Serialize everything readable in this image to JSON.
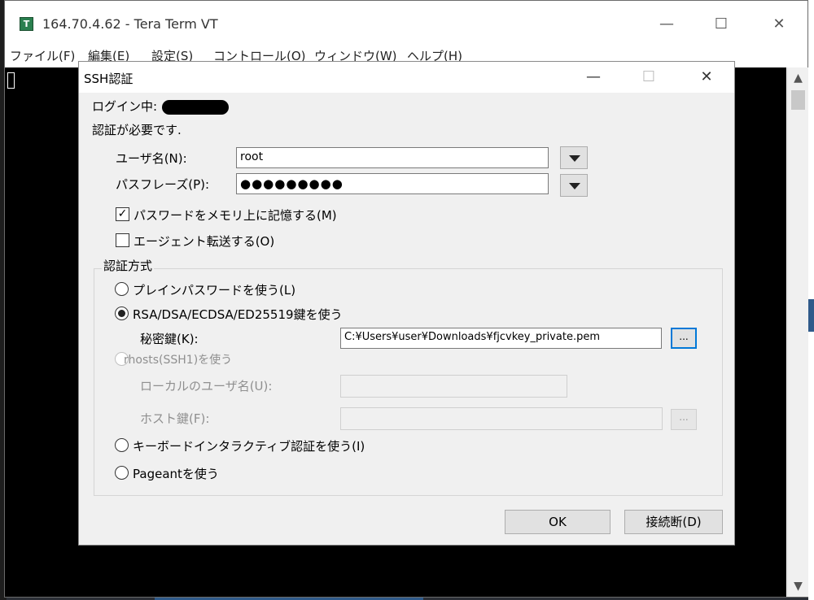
{
  "terminal_window": {
    "icon_letter": "T",
    "title": "164.70.4.62 - Tera Term VT",
    "controls": {
      "minimize": "—",
      "maximize": "☐",
      "close": "✕"
    },
    "menu": [
      "ファイル(F)",
      "編集(E)",
      "設定(S)",
      "コントロール(O)",
      "ウィンドウ(W)",
      "ヘルプ(H)"
    ],
    "scroll_up": "▲",
    "scroll_down": "▼"
  },
  "dialog": {
    "title": "SSH認証",
    "controls": {
      "minimize": "—",
      "maximize": "☐",
      "close": "✕"
    },
    "login_label": "ログイン中:",
    "auth_required": "認証が必要です.",
    "username_label": "ユーザ名(N):",
    "username_value": "root",
    "passphrase_label": "パスフレーズ(P):",
    "passphrase_value": "●●●●●●●●●",
    "remember_password": {
      "label": "パスワードをメモリ上に記憶する(M)",
      "checked": true,
      "check_glyph": "✓"
    },
    "agent_forwarding": {
      "label": "エージェント転送する(O)",
      "checked": false
    },
    "auth_method_legend": "認証方式",
    "methods": {
      "plain_password": "プレインパスワードを使う(L)",
      "rsa": "RSA/DSA/ECDSA/ED25519鍵を使う",
      "rhosts": "rhosts(SSH1)を使う",
      "keyboard_interactive": "キーボードインタラクティブ認証を使う(I)",
      "pageant": "Pageantを使う"
    },
    "selected_method": "rsa",
    "private_key_label": "秘密鍵(K):",
    "private_key_value": "C:¥Users¥user¥Downloads¥fjcvkey_private.pem",
    "browse_label": "...",
    "local_user_label": "ローカルのユーザ名(U):",
    "host_key_label": "ホスト鍵(F):",
    "ok_label": "OK",
    "disconnect_label": "接続断(D)"
  }
}
